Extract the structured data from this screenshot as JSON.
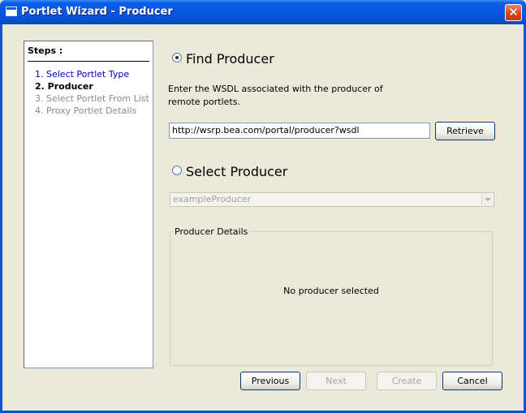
{
  "window": {
    "title": "Portlet Wizard - Producer",
    "close_glyph": "✕"
  },
  "steps": {
    "title": "Steps :",
    "items": [
      {
        "label": "1. Select Portlet Type",
        "state": "done"
      },
      {
        "label": "2. Producer",
        "state": "current"
      },
      {
        "label": "3. Select Portlet From List",
        "state": "future"
      },
      {
        "label": "4. Proxy Portlet Details",
        "state": "future"
      }
    ]
  },
  "find_producer": {
    "label": "Find Producer",
    "selected": true,
    "description": "Enter the WSDL associated with the producer of remote portlets.",
    "wsdl_value": "http://wsrp.bea.com/portal/producer?wsdl",
    "retrieve_label": "Retrieve"
  },
  "select_producer": {
    "label": "Select Producer",
    "selected": false,
    "selected_option": "exampleProducer"
  },
  "producer_details": {
    "title": "Producer Details",
    "message": "No producer selected"
  },
  "footer": {
    "previous_label": "Previous",
    "next_label": "Next",
    "create_label": "Create",
    "cancel_label": "Cancel"
  },
  "colors": {
    "titlebar": "#0855dd",
    "step_done": "#0000c8",
    "step_future": "#8a8a8a",
    "background": "#ece9d8"
  }
}
